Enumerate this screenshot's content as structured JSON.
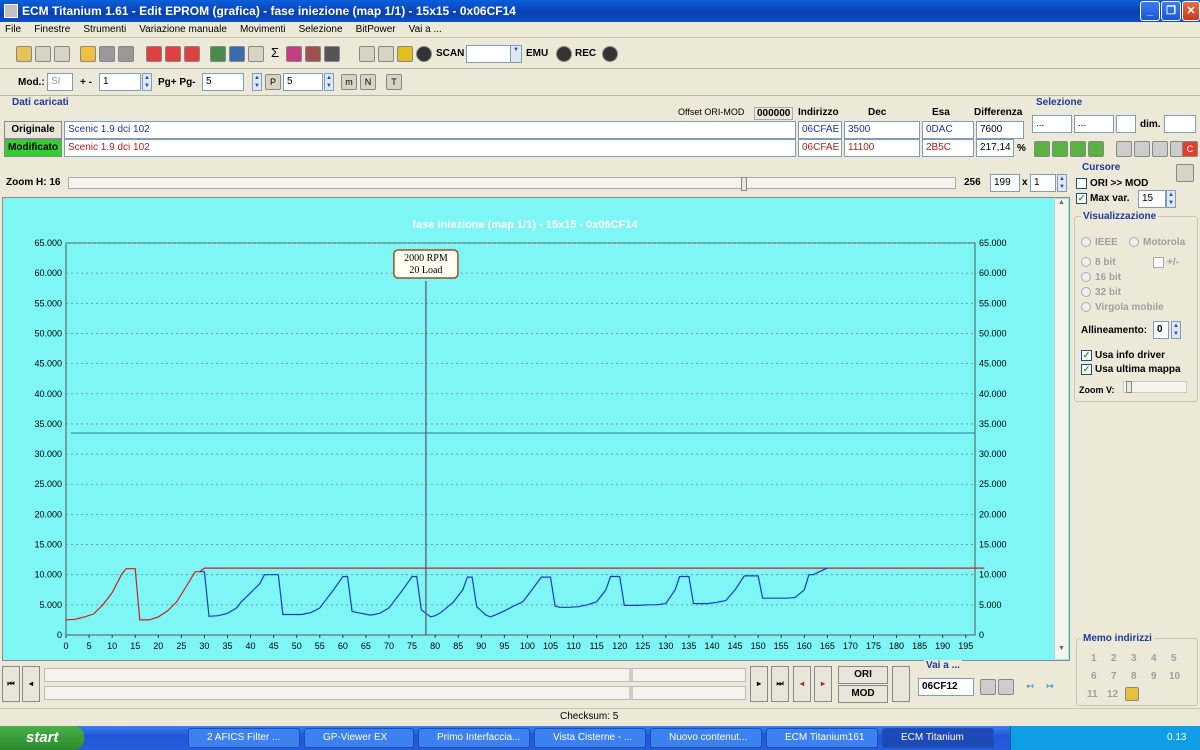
{
  "window": {
    "title": "ECM Titanium 1.61 - Edit EPROM (grafica) - fase iniezione (map 1/1) - 15x15 - 0x06CF14"
  },
  "menu": [
    "File",
    "Finestre",
    "Strumenti",
    "Variazione manuale",
    "Movimenti",
    "Selezione",
    "BitPower",
    "Vai a ..."
  ],
  "toolbar": {
    "scan": "SCAN",
    "emu": "EMU",
    "rec": "REC"
  },
  "toolbar2": {
    "mod_label": "Mod.:",
    "mod_value": "SI",
    "plusminus": "+ -",
    "step_value": "1",
    "pg_label": "Pg+ Pg-",
    "pg_value": "5",
    "p_value": "5"
  },
  "dati": {
    "title": "Dati caricati",
    "offset_label": "Offset ORI-MOD",
    "offset_value": "000000",
    "col_indirizzo": "Indirizzo",
    "col_dec": "Dec",
    "col_esa": "Esa",
    "col_diff": "Differenza",
    "orig_label": "Originale",
    "orig_name": "Scenic 1.9 dci 102",
    "orig_addr": "06CFAE",
    "orig_dec": "3500",
    "orig_esa": "0DAC",
    "orig_diff": "7600",
    "mod_label": "Modificato",
    "mod_name": "Scenic 1.9 dci 102",
    "mod_addr": "06CFAE",
    "mod_dec": "11100",
    "mod_esa": "2B5C",
    "mod_diff": "217,14",
    "pct": "%"
  },
  "selezione": {
    "title": "Selezione",
    "f1": "...",
    "f2": "...",
    "dim": "dim."
  },
  "zoom": {
    "label": "Zoom H: 16",
    "max": "256",
    "value": "199",
    "x": "x",
    "mult": "1"
  },
  "cursore": {
    "title": "Cursore",
    "ori_mod": "ORI >> MOD",
    "maxvar": "Max var.",
    "maxvar_value": "15"
  },
  "visual": {
    "title": "Visualizzazione",
    "ieee": "IEEE",
    "motorola": "Motorola",
    "b8": "8 bit",
    "pm": "+/-",
    "b16": "16 bit",
    "b32": "32 bit",
    "virgola": "Virgola mobile",
    "allin": "Allineamento:",
    "allin_value": "0",
    "info": "Usa info driver",
    "ultima": "Usa ultima mappa",
    "zoomv": "Zoom V:"
  },
  "memo": {
    "title": "Memo indirizzi",
    "nums": [
      "1",
      "2",
      "3",
      "4",
      "5",
      "6",
      "7",
      "8",
      "9",
      "10",
      "11",
      "12"
    ]
  },
  "vai": {
    "title": "Vai a ...",
    "value": "06CF12"
  },
  "nav": {
    "ori": "ORI",
    "mod": "MOD"
  },
  "status": {
    "checksum": "Checksum: 5"
  },
  "chart_data": {
    "type": "line",
    "title": "fase iniezione (map 1/1) - 15x15 - 0x06CF14",
    "xlim": [
      0,
      197
    ],
    "ylim": [
      0,
      65000
    ],
    "xticks": [
      0,
      5,
      10,
      15,
      20,
      25,
      30,
      35,
      40,
      45,
      50,
      55,
      60,
      65,
      70,
      75,
      80,
      85,
      90,
      95,
      100,
      105,
      110,
      115,
      120,
      125,
      130,
      135,
      140,
      145,
      150,
      155,
      160,
      165,
      170,
      175,
      180,
      185,
      190,
      195
    ],
    "yticks": [
      "0",
      "5.000",
      "10.000",
      "15.000",
      "20.000",
      "25.000",
      "30.000",
      "35.000",
      "40.000",
      "45.000",
      "50.000",
      "55.000",
      "60.000",
      "65.000"
    ],
    "yvals": [
      0,
      5000,
      10000,
      15000,
      20000,
      25000,
      30000,
      35000,
      40000,
      45000,
      50000,
      55000,
      60000,
      65000
    ],
    "hline": 33500,
    "cursor_x": 78,
    "cursor_label": [
      "2000 RPM",
      "20 Load"
    ],
    "series": [
      {
        "color": "#d02020",
        "x": [
          0,
          2,
          4,
          6,
          8,
          10,
          12,
          13,
          15,
          16,
          18,
          20,
          22,
          24,
          26,
          28,
          29,
          30,
          32,
          45,
          60,
          75,
          90,
          105,
          120,
          135,
          150,
          165,
          180,
          190,
          199
        ],
        "y": [
          2500,
          2600,
          3000,
          3500,
          5000,
          7000,
          10000,
          11000,
          11000,
          2500,
          2500,
          3000,
          4000,
          5500,
          8000,
          10500,
          10500,
          11100,
          11100,
          11100,
          11100,
          11100,
          11100,
          11100,
          11100,
          11100,
          11100,
          11100,
          11100,
          11100,
          11100
        ]
      },
      {
        "color": "#1a3cc8",
        "x": [
          29,
          30,
          31,
          33,
          35,
          37,
          38,
          40,
          42,
          43,
          45,
          46,
          47,
          49,
          51,
          53,
          55,
          56,
          58,
          60,
          61,
          62,
          64,
          66,
          68,
          70,
          71,
          73,
          75,
          76,
          77,
          78,
          79,
          80,
          81,
          82,
          84,
          86,
          87,
          88,
          89,
          90,
          91,
          92,
          93,
          95,
          97,
          99,
          101,
          103,
          104,
          105,
          106,
          107,
          109,
          111,
          113,
          115,
          117,
          118,
          119,
          120,
          121,
          122,
          124,
          126,
          128,
          130,
          132,
          133,
          134,
          135,
          136,
          137,
          139,
          141,
          143,
          145,
          147,
          148,
          149,
          150,
          151,
          152,
          154,
          156,
          158,
          160,
          161,
          162,
          163,
          165
        ],
        "y": [
          10500,
          10500,
          3100,
          3200,
          3600,
          4500,
          5500,
          7000,
          8500,
          10000,
          10000,
          10000,
          3400,
          3400,
          3400,
          3700,
          4500,
          5500,
          7500,
          9700,
          9700,
          3900,
          3600,
          3300,
          3600,
          4500,
          5500,
          7500,
          9700,
          9700,
          4200,
          3600,
          3000,
          3200,
          3600,
          4200,
          5500,
          7500,
          9600,
          9600,
          4700,
          4000,
          3300,
          3000,
          3300,
          4000,
          4800,
          5500,
          7500,
          9600,
          9600,
          9600,
          4800,
          4600,
          4600,
          4700,
          5000,
          5500,
          7500,
          9700,
          9700,
          9700,
          4900,
          4900,
          4900,
          5000,
          5000,
          5200,
          7500,
          9700,
          9700,
          9700,
          5200,
          5200,
          5200,
          5400,
          5700,
          7500,
          9800,
          9800,
          9800,
          9800,
          6100,
          6100,
          6100,
          6100,
          6200,
          7500,
          10000,
          10000,
          10400,
          11100
        ]
      }
    ]
  }
}
